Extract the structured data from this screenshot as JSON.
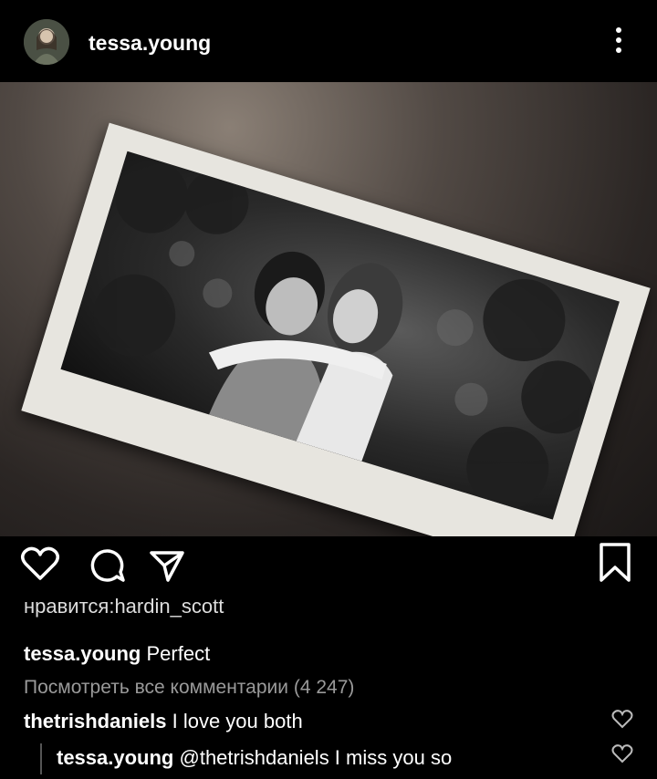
{
  "post": {
    "username": "tessa.young",
    "likes_text": "нравится:hardin_scott",
    "caption_user": "tessa.young",
    "caption_text": "Perfect",
    "view_all": "Посмотреть все комментарии (4 247)"
  },
  "comments": [
    {
      "user": "thetrishdaniels",
      "text": "I love you both"
    },
    {
      "user": "tessa.young",
      "text": "@thetrishdaniels I miss you so"
    }
  ],
  "icons": {
    "more": "more-vertical-icon",
    "like": "heart-icon",
    "comment": "comment-bubble-icon",
    "share": "send-icon",
    "save": "bookmark-icon",
    "comment_like": "heart-icon"
  },
  "colors": {
    "background": "#000000",
    "text": "#ffffff",
    "muted": "#9a9a9a"
  }
}
